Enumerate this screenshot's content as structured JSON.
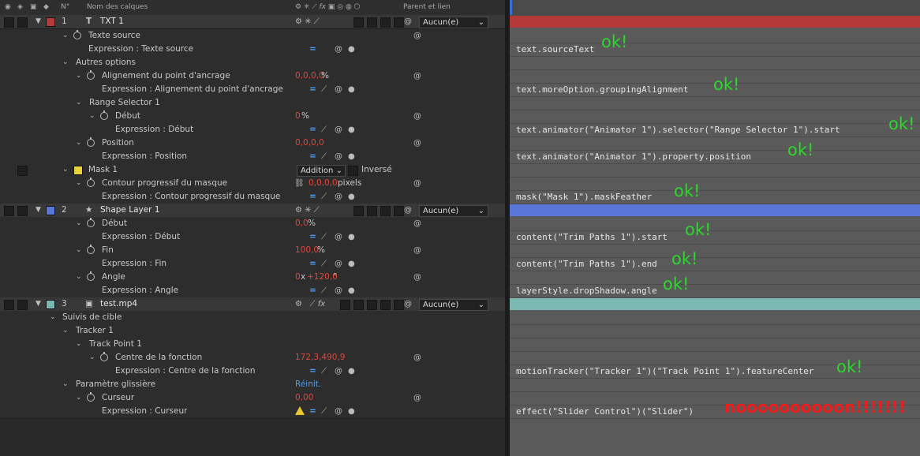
{
  "header": {
    "num": "N°",
    "layer_names": "Nom des calques",
    "parent": "Parent et lien"
  },
  "colors": {
    "red_label": "#b43a3a",
    "blue_label": "#5a76d9",
    "teal_label": "#7cb8b2",
    "yellow_mask": "#e6d23a"
  },
  "rows": {
    "r1": {
      "num": "1",
      "name": "TXT 1",
      "parent": "Aucun(e)"
    },
    "r2": {
      "name": "Texte source"
    },
    "r3": {
      "name": "Expression : Texte source"
    },
    "r4": {
      "name": "Autres options"
    },
    "r5": {
      "name": "Alignement du point d'ancrage",
      "value": "0,0,0,0",
      "unit": "%"
    },
    "r6": {
      "name": "Expression : Alignement du point d'ancrage"
    },
    "r7": {
      "name": "Range Selector 1"
    },
    "r8": {
      "name": "Début",
      "value": "0",
      "unit": "%"
    },
    "r9": {
      "name": "Expression : Début"
    },
    "r10": {
      "name": "Position",
      "value": "0,0,0,0"
    },
    "r11": {
      "name": "Expression : Position"
    },
    "r12": {
      "name": "Mask 1",
      "mode": "Addition",
      "inverse": "Inversé"
    },
    "r13": {
      "name": "Contour progressif du masque",
      "value": "0,0,0,0",
      "unit": "pixels"
    },
    "r14": {
      "name": "Expression : Contour progressif du masque"
    },
    "r15": {
      "num": "2",
      "name": "Shape Layer 1",
      "parent": "Aucun(e)"
    },
    "r16": {
      "name": "Début",
      "value": "0,0",
      "unit": "%"
    },
    "r17": {
      "name": "Expression : Début"
    },
    "r18": {
      "name": "Fin",
      "value": "100,0",
      "unit": "%"
    },
    "r19": {
      "name": "Expression : Fin"
    },
    "r20": {
      "name": "Angle",
      "value_a": "0",
      "value_x": "x",
      "value_b": "+120,0",
      "unit": "°"
    },
    "r21": {
      "name": "Expression : Angle"
    },
    "r22": {
      "num": "3",
      "name": "test.mp4",
      "parent": "Aucun(e)"
    },
    "r23": {
      "name": "Suivis de cible"
    },
    "r24": {
      "name": "Tracker 1"
    },
    "r25": {
      "name": "Track Point 1"
    },
    "r26": {
      "name": "Centre de la fonction",
      "value": "172,3,490,9"
    },
    "r27": {
      "name": "Expression : Centre de la fonction"
    },
    "r28": {
      "name": "Paramètre glissière",
      "value": "Réinit."
    },
    "r29": {
      "name": "Curseur",
      "value": "0,00"
    },
    "r30": {
      "name": "Expression : Curseur"
    }
  },
  "expressions": {
    "e1": "text.sourceText",
    "e2": "text.moreOption.groupingAlignment",
    "e3": "text.animator(\"Animator 1\").selector(\"Range Selector 1\").start",
    "e4": "text.animator(\"Animator 1\").property.position",
    "e5": "mask(\"Mask 1\").maskFeather",
    "e6": "content(\"Trim Paths 1\").start",
    "e7": "content(\"Trim Paths 1\").end",
    "e8": "layerStyle.dropShadow.angle",
    "e9": "motionTracker(\"Tracker 1\")(\"Track Point 1\").featureCenter",
    "e10": "effect(\"Slider Control\")(\"Slider\")"
  },
  "annotations": {
    "ok": "ok!",
    "fail": "noooooooooon!!!!!!!"
  }
}
